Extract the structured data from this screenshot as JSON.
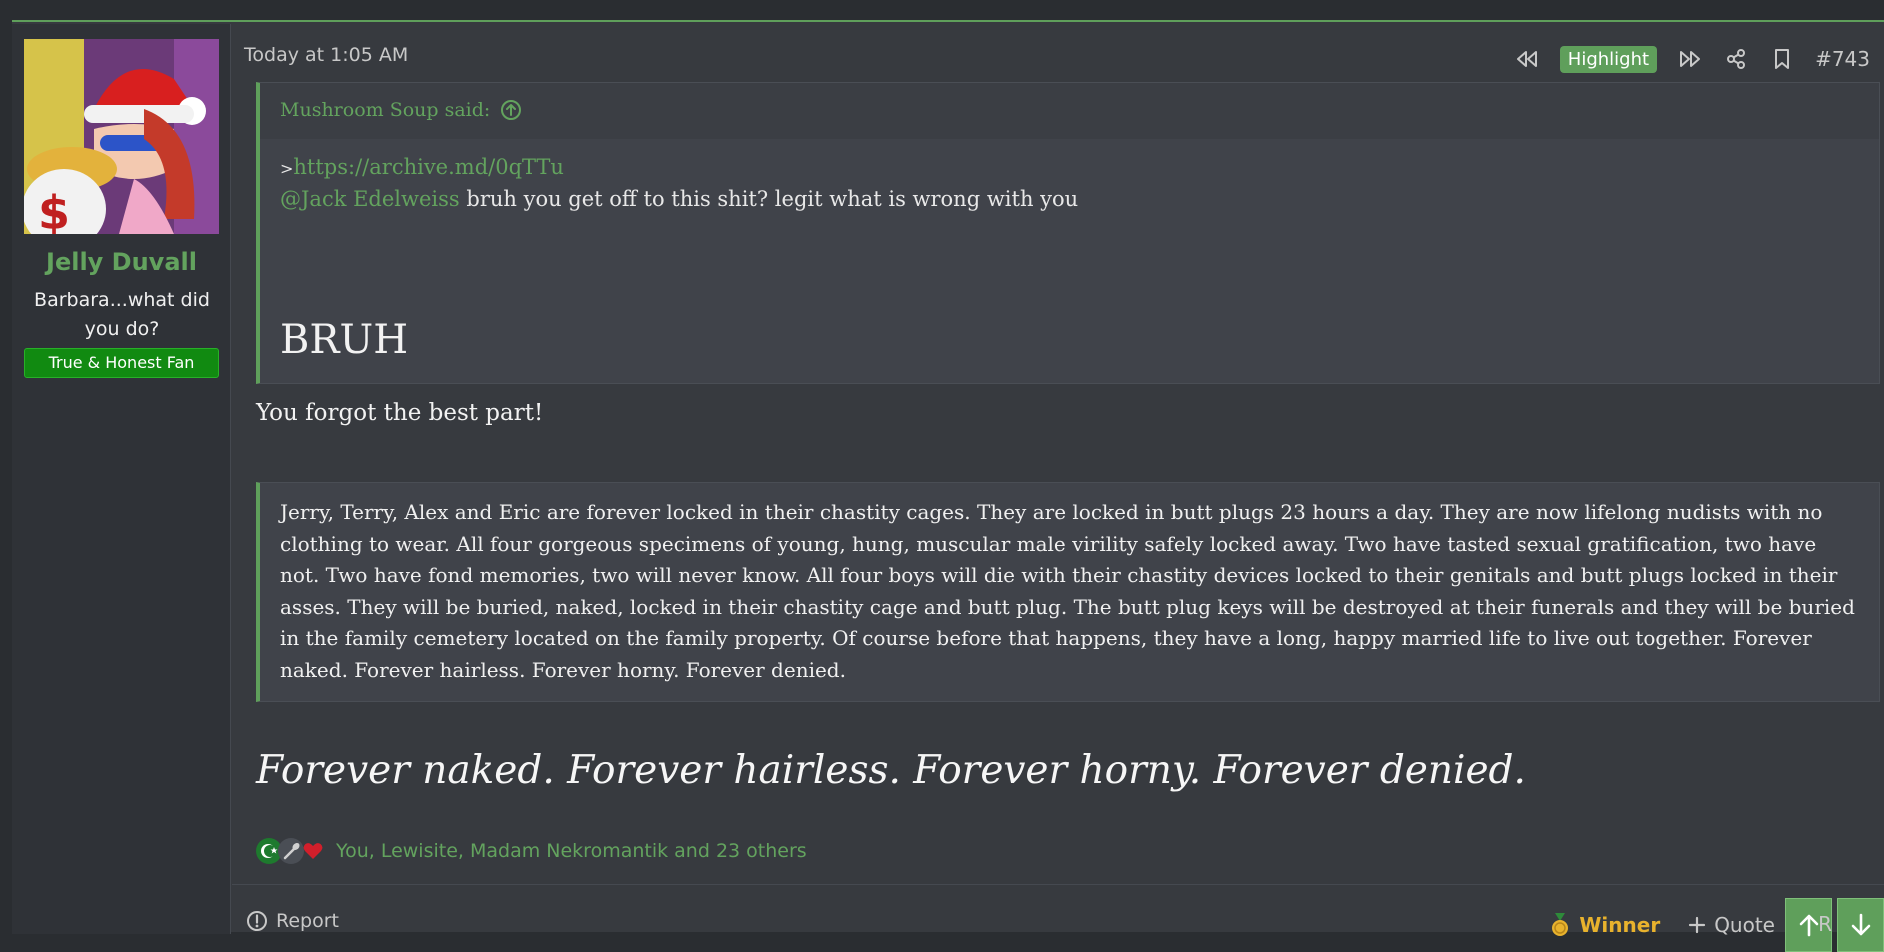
{
  "colors": {
    "accent": "#5f9f5b",
    "link": "#63a35e",
    "background": "#373a3f",
    "quote_bg": "#40434a",
    "winner": "#e8b22d",
    "banner": "#118a11"
  },
  "user": {
    "name": "Jelly Duvall",
    "title": "Barbara...what did you do?",
    "banner": "True & Honest Fan",
    "avatar_icon": "avatar-image"
  },
  "post": {
    "date": "Today at 1:05 AM",
    "highlight_label": "Highlight",
    "number": "#743",
    "actions_icons": [
      "rewind-icon",
      "fast-forward-icon",
      "share-icon",
      "bookmark-icon"
    ]
  },
  "quote1": {
    "attribution": "Mushroom Soup said:",
    "gt": ">",
    "link": "https://archive.md/0qTTu",
    "mention": "@Jack Edelweiss",
    "text": " bruh you get off to this shit? legit what is wrong with you",
    "big_text": "BRUH"
  },
  "reply": "You forgot the best part!",
  "quote2": {
    "text": "Jerry, Terry, Alex and Eric are forever locked in their chastity cages. They are locked in butt plugs 23 hours a day. They are now lifelong nudists with no clothing to wear. All four gorgeous specimens of young, hung, muscular male virility safely locked away. Two have tasted sexual gratification, two have not. Two have fond memories, two will never know. All four boys will die with their chastity devices locked to their genitals and butt plugs locked in their asses. They will be buried, naked, locked in their chastity cage and butt plug. The butt plug keys will be destroyed at their funerals and they will be buried in the family cemetery located on the family property. Of course before that happens, they have a long, happy married life to live out together. Forever naked. Forever hairless. Forever horny. Forever denied."
  },
  "emphasis": "Forever naked. Forever hairless. Forever horny. Forever denied.",
  "reactions": {
    "text": "You, Lewisite, Madam Nekromantik and 23 others",
    "icons": [
      "islam-reaction-icon",
      "spoon-reaction-icon",
      "heart-reaction-icon"
    ]
  },
  "footer": {
    "report_label": "Report",
    "winner_label": "Winner",
    "quote_label": "Quote",
    "reply_clip": "R"
  }
}
